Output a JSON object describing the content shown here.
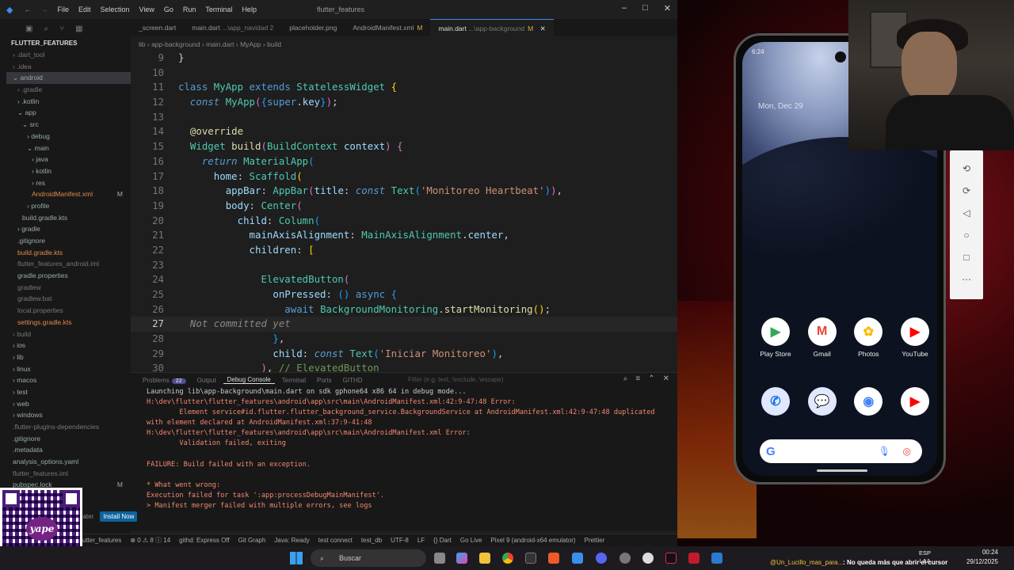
{
  "window": {
    "title": "flutter_features",
    "menu": [
      "File",
      "Edit",
      "Selection",
      "View",
      "Go",
      "Run",
      "Terminal",
      "Help"
    ]
  },
  "explorer": {
    "root": "FLUTTER_FEATURES",
    "items": [
      {
        "label": "› .dart_tool",
        "indent": 1,
        "dim": true
      },
      {
        "label": "› .idea",
        "indent": 1,
        "dim": true
      },
      {
        "label": "⌄ android",
        "indent": 1,
        "sel": true
      },
      {
        "label": "› .gradle",
        "indent": 2,
        "dim": true
      },
      {
        "label": "› .kotlin",
        "indent": 2
      },
      {
        "label": "⌄ app",
        "indent": 2
      },
      {
        "label": "⌄ src",
        "indent": 3
      },
      {
        "label": "› debug",
        "indent": 4
      },
      {
        "label": "⌄ main",
        "indent": 4
      },
      {
        "label": "› java",
        "indent": 5
      },
      {
        "label": "› kotlin",
        "indent": 5
      },
      {
        "label": "› res",
        "indent": 5
      },
      {
        "label": "AndroidManifest.xml",
        "indent": 5,
        "mark": "M",
        "orange": true
      },
      {
        "label": "› profile",
        "indent": 4
      },
      {
        "label": "build.gradle.kts",
        "indent": 3
      },
      {
        "label": "› gradle",
        "indent": 2
      },
      {
        "label": ".gitignore",
        "indent": 2
      },
      {
        "label": "build.gradle.kts",
        "indent": 2,
        "orange": true
      },
      {
        "label": "flutter_features_android.iml",
        "indent": 2,
        "dim": true
      },
      {
        "label": "gradle.properties",
        "indent": 2
      },
      {
        "label": "gradlew",
        "indent": 2,
        "dim": true
      },
      {
        "label": "gradlew.bat",
        "indent": 2,
        "dim": true
      },
      {
        "label": "local.properties",
        "indent": 2,
        "dim": true
      },
      {
        "label": "settings.gradle.kts",
        "indent": 2,
        "orange": true
      },
      {
        "label": "› build",
        "indent": 1,
        "dim": true
      },
      {
        "label": "› ios",
        "indent": 1
      },
      {
        "label": "› lib",
        "indent": 1
      },
      {
        "label": "› linux",
        "indent": 1
      },
      {
        "label": "› macos",
        "indent": 1
      },
      {
        "label": "› test",
        "indent": 1
      },
      {
        "label": "› web",
        "indent": 1
      },
      {
        "label": "› windows",
        "indent": 1
      },
      {
        "label": ".flutter-plugins-dependencies",
        "indent": 1,
        "dim": true
      },
      {
        "label": ".gitignore",
        "indent": 1
      },
      {
        "label": ".metadata",
        "indent": 1
      },
      {
        "label": "analysis_options.yaml",
        "indent": 1
      },
      {
        "label": "flutter_features.iml",
        "indent": 1,
        "dim": true
      },
      {
        "label": "pubspec.lock",
        "indent": 1,
        "mark": "M"
      }
    ]
  },
  "tabs": [
    {
      "label": "_screen.dart",
      "mark": ""
    },
    {
      "label": "main.dart",
      "hint": "...\\app_navidad 2",
      "mark": ""
    },
    {
      "label": "placeholder.png",
      "mark": ""
    },
    {
      "label": "AndroidManifest.xml",
      "mark": "M"
    },
    {
      "label": "main.dart",
      "hint": "...\\app-background",
      "mark": "M",
      "active": true
    }
  ],
  "breadcrumb": [
    "lib",
    "app-background",
    "main.dart",
    "MyApp",
    "build"
  ],
  "code_lines": [
    {
      "n": "9",
      "html": "<span class='pu'>}</span>"
    },
    {
      "n": "10",
      "html": ""
    },
    {
      "n": "11",
      "html": "<span class='kw'>class</span> <span class='cl'>MyApp</span> <span class='kw'>extends</span> <span class='cl'>StatelessWidget</span> <span class='br'>{</span>"
    },
    {
      "n": "12",
      "html": "  <span class='it'>const</span> <span class='cl'>MyApp</span><span class='bp'>(</span><span class='bb'>{</span><span class='kw'>super</span>.<span class='pm'>key</span><span class='bb'>}</span><span class='bp'>)</span>;"
    },
    {
      "n": "13",
      "html": ""
    },
    {
      "n": "14",
      "html": "  <span class='an'>@override</span>"
    },
    {
      "n": "15",
      "html": "  <span class='cl'>Widget</span> <span class='fn'>build</span><span class='bp'>(</span><span class='cl'>BuildContext</span> <span class='pm'>context</span><span class='bp'>)</span> <span class='bp'>{</span>"
    },
    {
      "n": "16",
      "html": "    <span class='it'>return</span> <span class='cl'>MaterialApp</span><span class='bb'>(</span>"
    },
    {
      "n": "17",
      "html": "      <span class='pm'>home</span>: <span class='cl'>Scaffold</span><span class='br'>(</span>"
    },
    {
      "n": "18",
      "html": "        <span class='pm'>appBar</span>: <span class='cl'>AppBar</span><span class='bp'>(</span><span class='pm'>title</span>: <span class='it'>const</span> <span class='cl'>Text</span><span class='bb'>(</span><span class='st'>'Monitoreo Heartbeat'</span><span class='bb'>)</span><span class='bp'>)</span>,"
    },
    {
      "n": "19",
      "html": "        <span class='pm'>body</span>: <span class='cl'>Center</span><span class='bp'>(</span>"
    },
    {
      "n": "20",
      "html": "          <span class='pm'>child</span>: <span class='cl'>Column</span><span class='bb'>(</span>"
    },
    {
      "n": "21",
      "html": "            <span class='pm'>mainAxisAlignment</span>: <span class='cl'>MainAxisAlignment</span>.<span class='pm'>center</span>,"
    },
    {
      "n": "22",
      "html": "            <span class='pm'>children</span>: <span class='br'>[</span>"
    },
    {
      "n": "23",
      "html": ""
    },
    {
      "n": "24",
      "html": "              <span class='cl'>ElevatedButton</span><span class='bp'>(</span>"
    },
    {
      "n": "25",
      "html": "                <span class='pm'>onPressed</span>: <span class='bb'>()</span> <span class='kw'>async</span> <span class='bb'>{</span>"
    },
    {
      "n": "26",
      "html": "                  <span class='kw'>await</span> <span class='cl'>BackgroundMonitoring</span>.<span class='fn'>startMonitoring</span><span class='br'>()</span>;"
    },
    {
      "n": "27",
      "html": "  <span class='ph'>Not committed yet</span>",
      "cur": true
    },
    {
      "n": "28",
      "html": "                <span class='bb'>}</span>,"
    },
    {
      "n": "29",
      "html": "                <span class='pm'>child</span>: <span class='it'>const</span> <span class='cl'>Text</span><span class='bb'>(</span><span class='st'>'Iniciar Monitoreo'</span><span class='bb'>)</span>,"
    },
    {
      "n": "30",
      "html": "              <span class='bp'>)</span>, <span class='cm'>// ElevatedButton</span>"
    }
  ],
  "panel": {
    "tabs": [
      "Problems",
      "Output",
      "Debug Console",
      "Terminal",
      "Ports",
      "GITHD"
    ],
    "problems_count": "22",
    "active_tab": "Debug Console",
    "filter_placeholder": "Filter (e.g. text, !exclude, \\escape)",
    "console": [
      {
        "t": "Launching lib\\app-background\\main.dart on sdk gphone64 x86 64 in debug mode...",
        "c": "c-w"
      },
      {
        "t": "H:\\dev\\flutter\\flutter_features\\android\\app\\src\\main\\AndroidManifest.xml:42:9-47:48 Error:",
        "c": "c-r"
      },
      {
        "t": "        Element service#id.flutter.flutter_background_service.BackgroundService at AndroidManifest.xml:42:9-47:48 duplicated with element declared at AndroidManifest.xml:37:9-41:48",
        "c": "c-r"
      },
      {
        "t": "H:\\dev\\flutter\\flutter_features\\android\\app\\src\\main\\AndroidManifest.xml Error:",
        "c": "c-r"
      },
      {
        "t": "        Validation failed, exiting",
        "c": "c-r"
      },
      {
        "t": "",
        "c": "c-w"
      },
      {
        "t": "FAILURE: Build failed with an exception.",
        "c": "c-r"
      },
      {
        "t": "",
        "c": "c-w"
      },
      {
        "t": "* What went wrong:",
        "c": "c-r"
      },
      {
        "t": "Execution failed for task ':app:processDebugMainManifest'.",
        "c": "c-r"
      },
      {
        "t": "> Manifest merger failed with multiple errors, see logs",
        "c": "c-r"
      }
    ]
  },
  "notification": {
    "later": "Later",
    "install": "Install Now"
  },
  "statusbar": [
    "flutter_features",
    "⊗ 0 ⚠ 8 ⓘ 14",
    "githd: Express Off",
    "Git Graph",
    "Java: Ready",
    "test connect",
    "test_db",
    "UTF-8",
    "LF",
    "{} Dart",
    "Go Live",
    "Pixel 9 (android-x64 emulator)",
    "Prettier"
  ],
  "phone": {
    "time": "6:24",
    "date": "Mon, Dec 29",
    "row1": [
      {
        "label": "Play Store",
        "icon": "play-store-icon",
        "color": "#ffffff",
        "glyph": "▶"
      },
      {
        "label": "Gmail",
        "icon": "gmail-icon",
        "color": "#ffffff",
        "glyph": "M"
      },
      {
        "label": "Photos",
        "icon": "photos-icon",
        "color": "#ffffff",
        "glyph": "✿"
      },
      {
        "label": "YouTube",
        "icon": "youtube-icon",
        "color": "#ffffff",
        "glyph": "▶"
      }
    ],
    "row2": [
      {
        "label": "",
        "icon": "phone-icon",
        "color": "#dfe8ff",
        "glyph": "✆"
      },
      {
        "label": "",
        "icon": "messages-icon",
        "color": "#dfe8ff",
        "glyph": "💬"
      },
      {
        "label": "",
        "icon": "chrome-icon",
        "color": "#ffffff",
        "glyph": "◉"
      },
      {
        "label": "",
        "icon": "youtube-icon",
        "color": "#ffffff",
        "glyph": "▶"
      }
    ]
  },
  "taskbar": {
    "search": "Buscar",
    "chat_user": "@Un_Lucillo_mas_para...",
    "chat_msg": ": No queda más que abrir el cursor",
    "lang": "ESP",
    "lang2": "LAA",
    "time": "00:24",
    "date": "29/12/2025"
  }
}
